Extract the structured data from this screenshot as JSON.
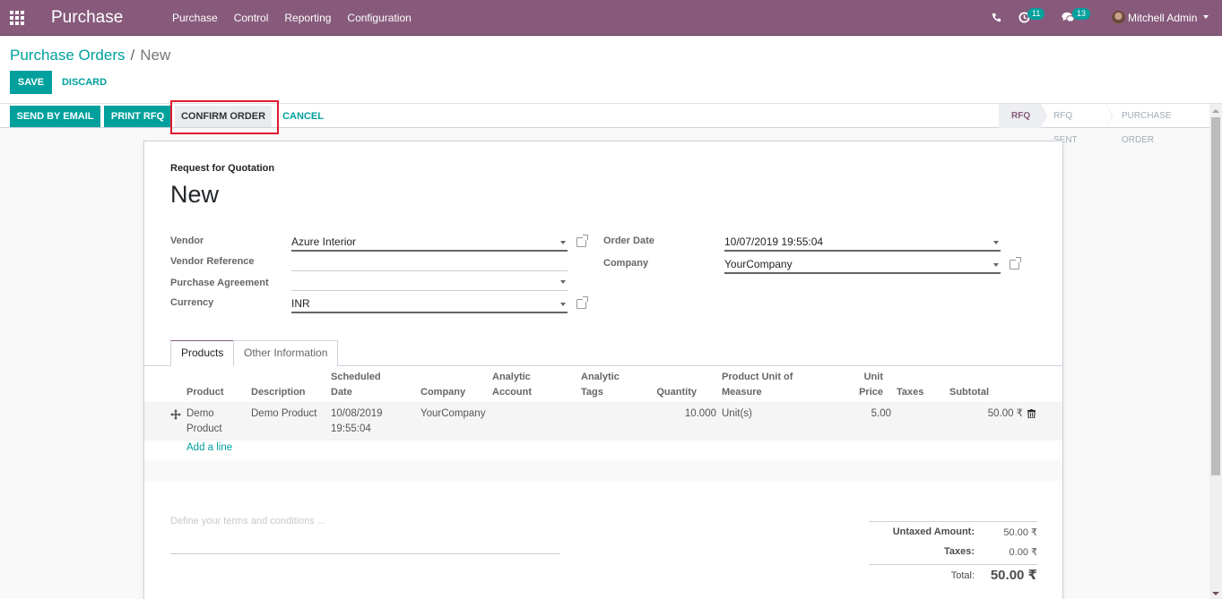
{
  "navbar": {
    "app_title": "Purchase",
    "menu": [
      "Purchase",
      "Control",
      "Reporting",
      "Configuration"
    ],
    "activities_count": "11",
    "messages_count": "13",
    "user_name": "Mitchell Admin",
    "icons": {
      "apps": "apps-grid-icon",
      "phone": "phone-icon",
      "activity": "clock-icon",
      "messages": "chat-icon"
    }
  },
  "breadcrumb": {
    "parent": "Purchase Orders",
    "separator": "/",
    "current": "New"
  },
  "control": {
    "save_label": "SAVE",
    "discard_label": "DISCARD"
  },
  "statusbar": {
    "buttons": {
      "send_email": "SEND BY EMAIL",
      "print_rfq": "PRINT RFQ",
      "confirm_order": "CONFIRM ORDER",
      "cancel": "CANCEL"
    },
    "stages": [
      {
        "label": "RFQ",
        "active": true
      },
      {
        "label": "RFQ SENT",
        "active": false
      },
      {
        "label": "PURCHASE ORDER",
        "active": false
      }
    ]
  },
  "form": {
    "subtitle": "Request for Quotation",
    "title": "New",
    "fields": {
      "vendor": {
        "label": "Vendor",
        "value": "Azure Interior"
      },
      "vendor_reference": {
        "label": "Vendor Reference",
        "value": ""
      },
      "purchase_agreement": {
        "label": "Purchase Agreement",
        "value": ""
      },
      "currency": {
        "label": "Currency",
        "value": "INR"
      },
      "order_date": {
        "label": "Order Date",
        "value": "10/07/2019 19:55:04"
      },
      "company": {
        "label": "Company",
        "value": "YourCompany"
      }
    },
    "tabs": [
      {
        "label": "Products",
        "active": true
      },
      {
        "label": "Other Information",
        "active": false
      }
    ],
    "table": {
      "columns": {
        "product": "Product",
        "description": "Description",
        "scheduled_date": [
          "Scheduled",
          "Date"
        ],
        "company": "Company",
        "analytic_account": [
          "Analytic",
          "Account"
        ],
        "analytic_tags": [
          "Analytic",
          "Tags"
        ],
        "quantity": "Quantity",
        "uom": [
          "Product Unit of",
          "Measure"
        ],
        "unit_price": [
          "Unit",
          "Price"
        ],
        "taxes": "Taxes",
        "subtotal": "Subtotal"
      },
      "rows": [
        {
          "product": [
            "Demo",
            "Product"
          ],
          "description": "Demo Product",
          "scheduled_date": [
            "10/08/2019",
            "19:55:04"
          ],
          "company": "YourCompany",
          "analytic_account": "",
          "analytic_tags": "",
          "quantity": "10.000",
          "uom": "Unit(s)",
          "unit_price": "5.00",
          "taxes": "",
          "subtotal": "50.00 ₹"
        }
      ],
      "add_line_label": "Add a line"
    },
    "terms_placeholder": "Define your terms and conditions ...",
    "totals": {
      "untaxed_label": "Untaxed Amount:",
      "untaxed_value": "50.00 ₹",
      "taxes_label": "Taxes:",
      "taxes_value": "0.00 ₹",
      "total_label": "Total:",
      "total_value": "50.00 ₹"
    }
  },
  "colors": {
    "brand": "#875a7b",
    "accent": "#00a09d",
    "highlight": "#e0192f"
  }
}
